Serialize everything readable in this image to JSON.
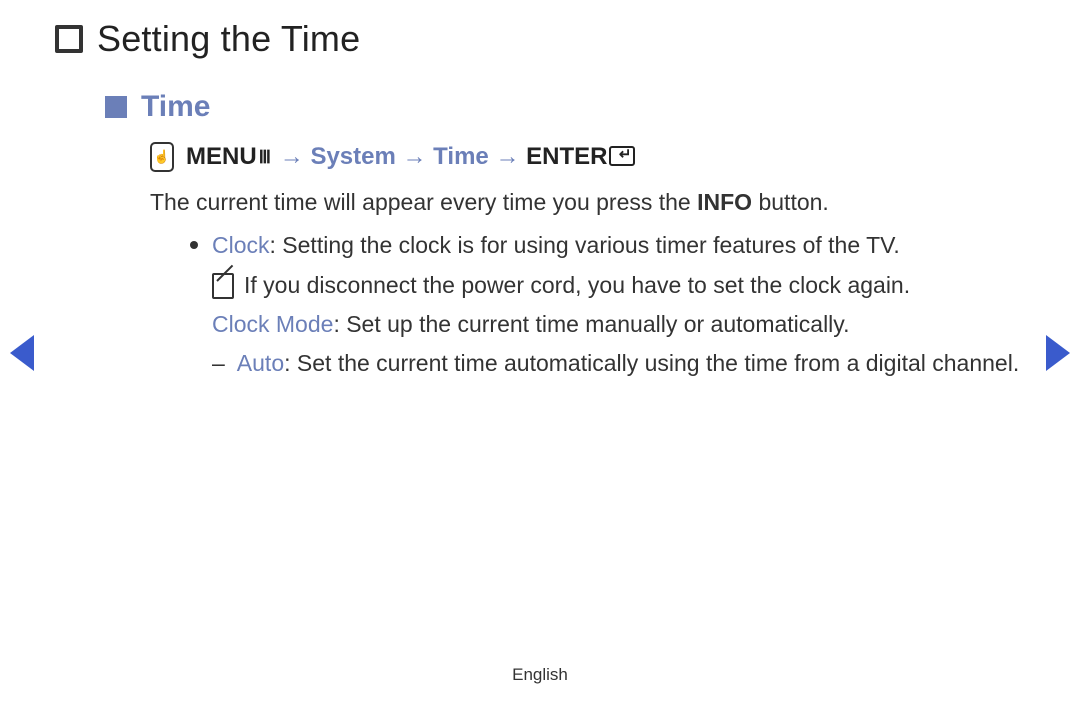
{
  "page": {
    "title": "Setting the Time",
    "section_heading": "Time",
    "nav": {
      "menu_label": "MENU",
      "menu_glyph": "Ⅲ",
      "arrow": "→",
      "system": "System",
      "time": "Time",
      "enter_label": "ENTER"
    },
    "intro_pre": "The current time will appear every time you press the ",
    "intro_bold": "INFO",
    "intro_post": " button.",
    "clock": {
      "term": "Clock",
      "text": ": Setting the clock is for using various timer features of the TV.",
      "note": "If you disconnect the power cord, you have to set the clock again."
    },
    "clock_mode": {
      "term": "Clock Mode",
      "text": ": Set up the current time manually or automatically."
    },
    "auto": {
      "dash": "–",
      "term": "Auto",
      "text": ": Set the current time automatically using the time from a digital channel."
    },
    "footer": "English"
  }
}
